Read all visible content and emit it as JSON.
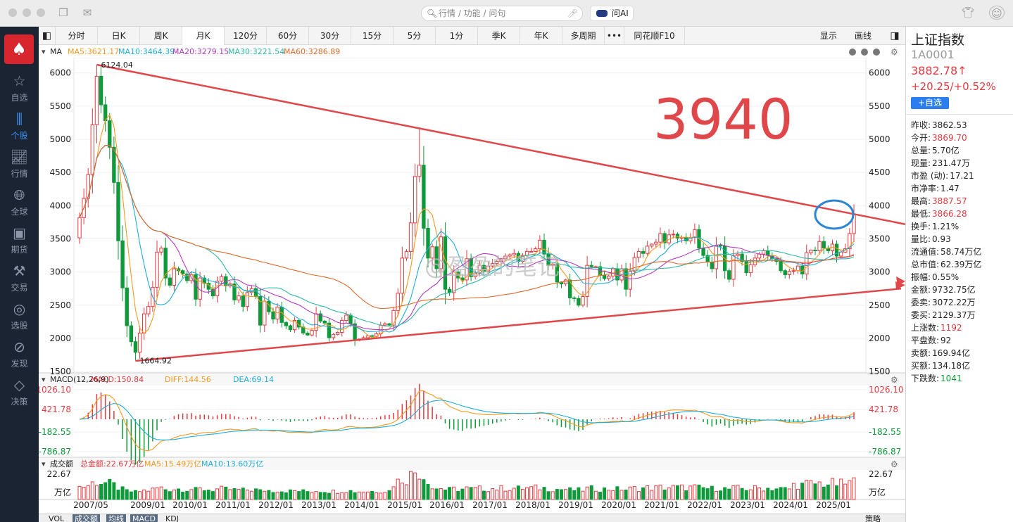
{
  "search": {
    "placeholder": "行情 / 功能 / 问句"
  },
  "ask_ai": {
    "label": "问AI"
  },
  "sidebar": {
    "items": [
      {
        "label": "自选",
        "icon": "star-icon"
      },
      {
        "label": "个股",
        "icon": "candlestick-icon"
      },
      {
        "label": "行情",
        "icon": "trend-chart-icon"
      },
      {
        "label": "全球",
        "icon": "globe-icon"
      },
      {
        "label": "期货",
        "icon": "futures-icon"
      },
      {
        "label": "交易",
        "icon": "trade-icon"
      },
      {
        "label": "选股",
        "icon": "stock-picker-icon"
      },
      {
        "label": "发现",
        "icon": "compass-icon"
      },
      {
        "label": "决策",
        "icon": "decision-icon"
      }
    ]
  },
  "tabs": [
    "分时",
    "日K",
    "周K",
    "月K",
    "120分",
    "60分",
    "30分",
    "15分",
    "5分",
    "1分",
    "季K",
    "年K",
    "多周期",
    "•••",
    "同花顺F10"
  ],
  "active_tab": "月K",
  "toolbar": {
    "display": "显示",
    "draw": "画线"
  },
  "indicators": {
    "ma_label": "MA",
    "ma5": "MA5:3621.17",
    "ma10": "MA10:3464.39",
    "ma20": "MA20:3279.15",
    "ma30": "MA30:3221.54",
    "ma60": "MA60:3286.89",
    "macd_label": "MACD(12,26,9)",
    "macd": "MACD:150.84",
    "diff": "DIFF:144.56",
    "dea": "DEA:69.14",
    "vol_label": "成交额",
    "vol_total": "总金额:22.67万亿",
    "vol_ma5": "MA5:15.49万亿",
    "vol_ma10": "MA10:13.60万亿"
  },
  "annotation": {
    "big_number": "3940",
    "watermark": "@盈盈的笔记"
  },
  "colors": {
    "up": "#e23b41",
    "down": "#0e9a3a",
    "ma5": "#f39a1e",
    "ma10": "#1faed6",
    "ma20": "#b43cc0",
    "ma30": "#2fb8a6",
    "ma60": "#e06a2b",
    "trend": "#e0474a",
    "circle": "#2b86d6"
  },
  "chart_data": {
    "type": "candlestick",
    "y_axis": {
      "ticks": [
        6000,
        5500,
        5000,
        4500,
        4000,
        3500,
        3000,
        2500,
        2000,
        1500
      ],
      "range": [
        1480,
        6230
      ]
    },
    "macd_axis": {
      "ticks": [
        "1026.10",
        "421.78",
        "-182.55",
        "-786.87"
      ]
    },
    "vol_axis": {
      "ticks": [
        "22.67",
        "万亿"
      ]
    },
    "x_labels": [
      "2007/05",
      "2009/01",
      "2010/01",
      "2011/01",
      "2012/01",
      "2013/01",
      "2014/01",
      "2015/01",
      "2016/01",
      "2017/01",
      "2018/01",
      "2019/01",
      "2020/01",
      "2021/01",
      "2022/01",
      "2023/01",
      "2024/01",
      "2025/01"
    ],
    "high_label": "6124.04",
    "low_label": "1664.92",
    "closes": [
      3820,
      4110,
      4470,
      5220,
      5950,
      5520,
      5280,
      4880,
      4350,
      3470,
      2760,
      2190,
      1950,
      1790,
      2080,
      2370,
      2480,
      2770,
      3300,
      3360,
      2910,
      2800,
      3050,
      3020,
      2970,
      2870,
      2960,
      2590,
      2910,
      2830,
      2740,
      2640,
      2860,
      2930,
      2790,
      2820,
      2580,
      2640,
      2480,
      2690,
      2750,
      2630,
      2200,
      2560,
      2400,
      2290,
      2470,
      2240,
      2190,
      2130,
      2270,
      2170,
      2080,
      2050,
      2120,
      2370,
      2260,
      2230,
      2010,
      2060,
      2090,
      2270,
      2350,
      2220,
      1970,
      1990,
      2010,
      2040,
      2030,
      2070,
      2200,
      2220,
      2200,
      2420,
      2680,
      3210,
      3310,
      3740,
      4440,
      4610,
      3660,
      3210,
      3380,
      3050,
      3530,
      2740,
      2690,
      3000,
      2910,
      2880,
      3200,
      2930,
      2980,
      3100,
      3010,
      3090,
      3130,
      3160,
      3200,
      3240,
      3260,
      3280,
      3160,
      3250,
      3310,
      3310,
      3350,
      3480,
      3270,
      3100,
      3120,
      2850,
      2820,
      2880,
      2610,
      2600,
      2500,
      2630,
      3100,
      3080,
      3080,
      2950,
      2900,
      2940,
      3050,
      2880,
      3050,
      2740,
      3010,
      3220,
      3310,
      3280,
      3390,
      3420,
      3450,
      3580,
      3440,
      3560,
      3570,
      3510,
      3520,
      3470,
      3520,
      3640,
      3360,
      3250,
      3150,
      3050,
      3400,
      3390,
      3020,
      2890,
      3250,
      3270,
      3160,
      2990,
      3110,
      3210,
      3270,
      3320,
      3250,
      3200,
      3160,
      3020,
      2960,
      3010,
      3020,
      3090,
      2970,
      3290,
      3330,
      3320,
      3460,
      3360,
      3320,
      3420,
      3240,
      3300,
      3350,
      3580,
      3870
    ]
  }
}
